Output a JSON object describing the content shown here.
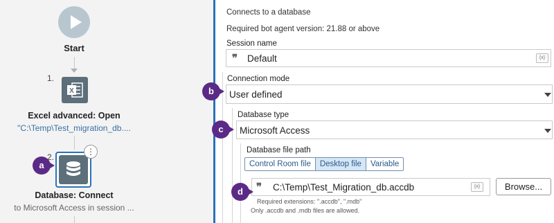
{
  "flow": {
    "start_label": "Start",
    "steps": [
      {
        "number": "1.",
        "title": "Excel advanced: Open",
        "subtitle": "\"C:\\Temp\\Test_migration_db...."
      },
      {
        "number": "2.",
        "title": "Database: Connect",
        "subtitle": "to Microsoft Access in session ..."
      }
    ],
    "more_options_glyph": "⋮"
  },
  "callouts": {
    "a": "a",
    "b": "b",
    "c": "c",
    "d": "d"
  },
  "props": {
    "description": "Connects to a database",
    "version": "Required bot agent version: 21.88 or above",
    "session": {
      "label": "Session name",
      "value": "Default",
      "var_glyph": "{x}"
    },
    "connection_mode": {
      "label": "Connection mode",
      "value": "User defined"
    },
    "database_type": {
      "label": "Database type",
      "value": "Microsoft Access"
    },
    "file_path": {
      "label": "Database file path",
      "tabs": [
        "Control Room file",
        "Desktop file",
        "Variable"
      ],
      "active_tab": "Desktop file",
      "value": "C:\\Temp\\Test_Migration_db.accdb",
      "var_glyph": "{x}",
      "browse_label": "Browse...",
      "required_ext": "Required extensions: \".accdb\", \".mdb\"",
      "allowed_note": "Only .accdb and .mdb files are allowed."
    },
    "quote_glyph": "❞"
  },
  "colors": {
    "accent": "#2a72b8",
    "callout": "#5b2a86",
    "node": "#5c6f7a"
  }
}
